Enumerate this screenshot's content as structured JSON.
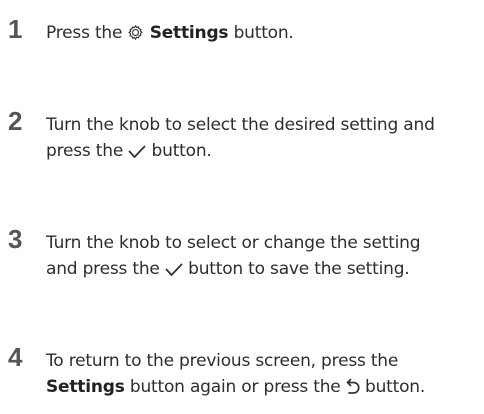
{
  "steps": [
    {
      "number": "1",
      "text_before": "Press the",
      "icon": "gear-icon",
      "bold": "Settings",
      "text_after": "button."
    },
    {
      "number": "2",
      "line1": "Turn the knob to select the desired setting and",
      "line2_before": "press the",
      "icon": "checkmark-icon",
      "line2_after": "button."
    },
    {
      "number": "3",
      "line1": "Turn the knob to select or change the setting",
      "line2_before": "and press the",
      "icon": "checkmark-icon",
      "line2_after": "button to save the setting."
    },
    {
      "number": "4",
      "line1": "To return to the previous screen, press the",
      "line2_bold": "Settings",
      "line2_middle": "button again or press the",
      "icon": "back-arrow-icon",
      "line2_after": "button."
    }
  ]
}
